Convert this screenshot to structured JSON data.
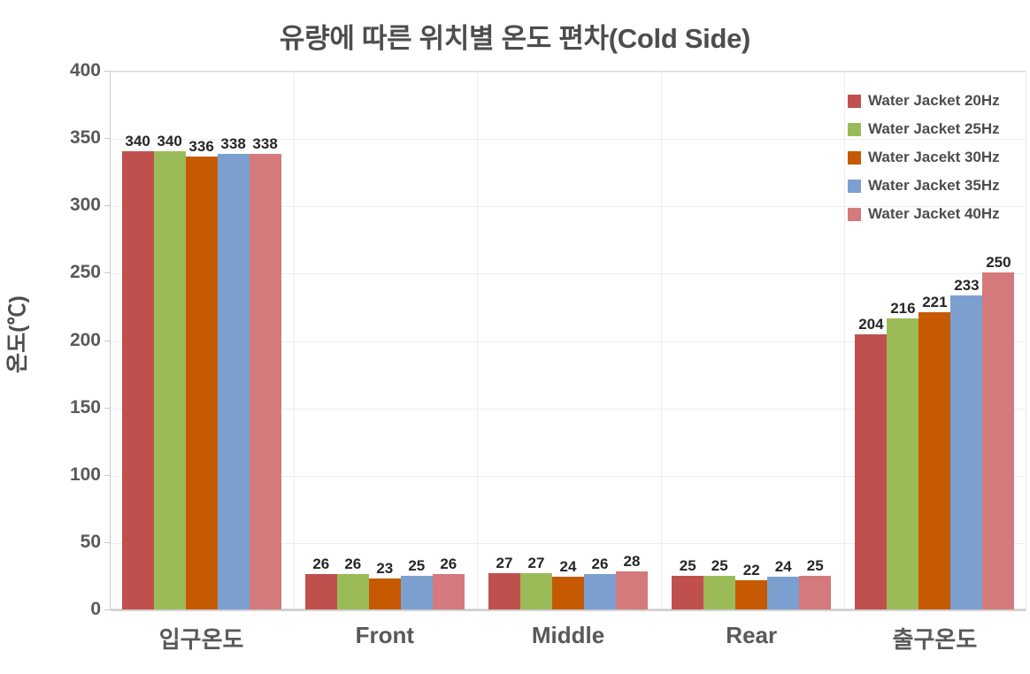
{
  "chart_data": {
    "type": "bar",
    "title": "유량에 따른 위치별 온도 편차(Cold Side)",
    "xlabel": "",
    "ylabel": "온도(℃)",
    "ylim": [
      0,
      400
    ],
    "ytick_step": 50,
    "yticks": [
      "400",
      "350",
      "300",
      "250",
      "200",
      "150",
      "100",
      "50",
      "0"
    ],
    "grid": true,
    "legend_position": "top-right-inside",
    "categories": [
      "입구온도",
      "Front",
      "Middle",
      "Rear",
      "출구온도"
    ],
    "series": [
      {
        "name": "Water Jacket 20Hz",
        "color": "#c0504d",
        "values": [
          340,
          26,
          27,
          25,
          204
        ]
      },
      {
        "name": "Water Jacket 25Hz",
        "color": "#9bbb59",
        "values": [
          340,
          26,
          27,
          25,
          216
        ]
      },
      {
        "name": "Water Jacekt 30Hz",
        "color": "#c55a02",
        "values": [
          336,
          23,
          24,
          22,
          221
        ]
      },
      {
        "name": "Water Jacket 35Hz",
        "color": "#7ba0d0",
        "values": [
          338,
          25,
          26,
          24,
          233
        ]
      },
      {
        "name": "Water Jacket 40Hz",
        "color": "#d4797c",
        "values": [
          338,
          26,
          28,
          25,
          250
        ]
      }
    ]
  },
  "colors": {
    "title_text": "#4d4d4d",
    "axis_text": "#595959",
    "data_label_text": "#262626",
    "gridline": "#ededed",
    "plot_border": "#d9d9d9",
    "background": "#ffffff"
  }
}
